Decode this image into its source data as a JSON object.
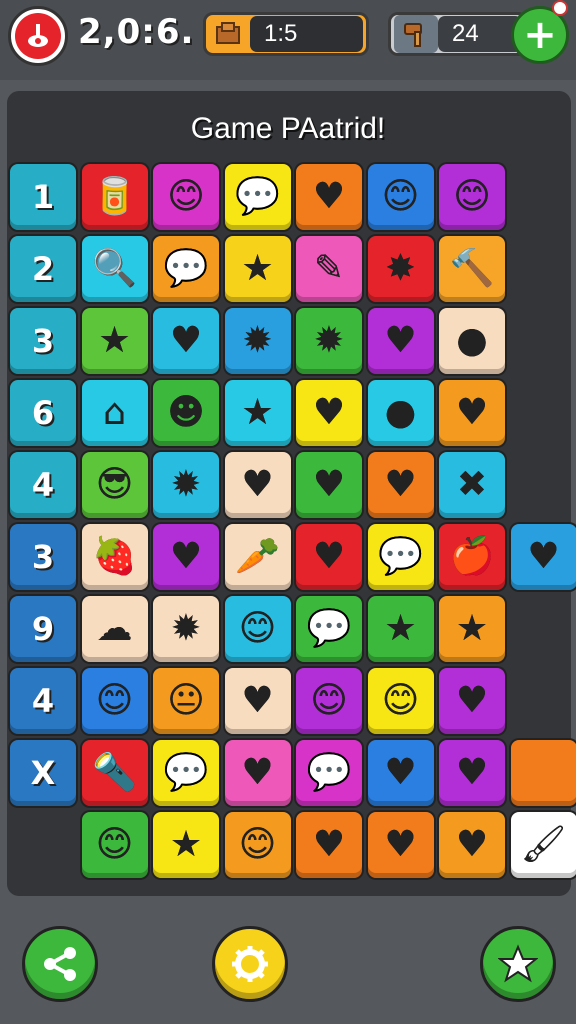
{
  "header": {
    "score": "2,0:6.",
    "resource1": {
      "value": "1:5",
      "icon": "wood-block-icon"
    },
    "resource2": {
      "value": "24",
      "icon": "hammer-icon"
    },
    "add_label": "+"
  },
  "board": {
    "title": "Game PAatrid!",
    "rows": [
      {
        "label": "1",
        "label_color": "#27aec6",
        "cells": [
          {
            "color": "#e4232b",
            "glyph": "🥫",
            "icon": "can-icon"
          },
          {
            "color": "#d733c8",
            "glyph": "😊",
            "icon": "face-icon"
          },
          {
            "color": "#f7e614",
            "glyph": "💬",
            "icon": "speech-bubble-icon"
          },
          {
            "color": "#f27c1c",
            "glyph": "♥",
            "icon": "heart-icon"
          },
          {
            "color": "#2a7fe0",
            "glyph": "😊",
            "icon": "face-icon"
          },
          {
            "color": "#b22ed6",
            "glyph": "😊",
            "icon": "face-icon"
          }
        ]
      },
      {
        "label": "2",
        "label_color": "#27aec6",
        "cells": [
          {
            "color": "#28c9e4",
            "glyph": "🔍",
            "icon": "magnifier-icon"
          },
          {
            "color": "#f39a1f",
            "glyph": "💬",
            "icon": "speech-bubble-icon"
          },
          {
            "color": "#f7d21b",
            "glyph": "★",
            "icon": "star-icon"
          },
          {
            "color": "#ee58b8",
            "glyph": "✎",
            "icon": "ribbon-icon"
          },
          {
            "color": "#e4232b",
            "glyph": "✸",
            "icon": "splat-icon"
          },
          {
            "color": "#f7a528",
            "glyph": "🔨",
            "icon": "hammer-icon"
          }
        ]
      },
      {
        "label": "3",
        "label_color": "#27aec6",
        "cells": [
          {
            "color": "#5cc53a",
            "glyph": "★",
            "icon": "star-icon"
          },
          {
            "color": "#28bde0",
            "glyph": "♥",
            "icon": "heart-icon"
          },
          {
            "color": "#2a9fe0",
            "glyph": "✹",
            "icon": "gear-badge-icon"
          },
          {
            "color": "#3cb83c",
            "glyph": "✹",
            "icon": "gear-badge-icon"
          },
          {
            "color": "#b22ed6",
            "glyph": "♥",
            "icon": "heart-icon"
          },
          {
            "color": "#f8dcc0",
            "glyph": "●",
            "icon": "bubble-icon"
          }
        ]
      },
      {
        "label": "6",
        "label_color": "#27aec6",
        "cells": [
          {
            "color": "#28c9e4",
            "glyph": "⌂",
            "icon": "house-icon"
          },
          {
            "color": "#3cb83c",
            "glyph": "☻",
            "icon": "blob-face-icon"
          },
          {
            "color": "#28c9e4",
            "glyph": "★",
            "icon": "star-icon"
          },
          {
            "color": "#f7e614",
            "glyph": "♥",
            "icon": "heart-icon"
          },
          {
            "color": "#28c9e4",
            "glyph": "●",
            "icon": "ball-icon"
          },
          {
            "color": "#f39a1f",
            "glyph": "♥",
            "icon": "heart-icon"
          }
        ]
      },
      {
        "label": "4",
        "label_color": "#27aec6",
        "cells": [
          {
            "color": "#5cc53a",
            "glyph": "😎",
            "icon": "face-icon"
          },
          {
            "color": "#28bde0",
            "glyph": "✹",
            "icon": "gear-badge-icon"
          },
          {
            "color": "#f8dcc0",
            "glyph": "♥",
            "icon": "heart-icon"
          },
          {
            "color": "#3cb83c",
            "glyph": "♥",
            "icon": "heart-icon"
          },
          {
            "color": "#f27c1c",
            "glyph": "♥",
            "icon": "heart-icon"
          },
          {
            "color": "#28bde0",
            "glyph": "✖",
            "icon": "cross-icon"
          }
        ]
      },
      {
        "label": "3",
        "label_color": "#2b78c2",
        "cells": [
          {
            "color": "#f8dcc0",
            "glyph": "🍓",
            "icon": "strawberry-icon"
          },
          {
            "color": "#b22ed6",
            "glyph": "♥",
            "icon": "heart-icon"
          },
          {
            "color": "#f8dcc0",
            "glyph": "🥕",
            "icon": "carrot-icon"
          },
          {
            "color": "#e4232b",
            "glyph": "♥",
            "icon": "heart-icon"
          },
          {
            "color": "#f7e614",
            "glyph": "💬",
            "icon": "speech-bubble-icon"
          },
          {
            "color": "#e4232b",
            "glyph": "🍎",
            "icon": "apple-icon"
          },
          {
            "color": "#2a9fe0",
            "glyph": "♥",
            "icon": "heart-icon"
          }
        ]
      },
      {
        "label": "9",
        "label_color": "#2b78c2",
        "cells": [
          {
            "color": "#f8dcc0",
            "glyph": "☁",
            "icon": "cloud-icon"
          },
          {
            "color": "#f8dcc0",
            "glyph": "✹",
            "icon": "gear-badge-icon"
          },
          {
            "color": "#28bde0",
            "glyph": "😊",
            "icon": "face-icon"
          },
          {
            "color": "#3cb83c",
            "glyph": "💬",
            "icon": "speech-bubble-icon"
          },
          {
            "color": "#3cb83c",
            "glyph": "★",
            "icon": "star-icon"
          },
          {
            "color": "#f39a1f",
            "glyph": "★",
            "icon": "star-icon"
          }
        ]
      },
      {
        "label": "4",
        "label_color": "#2b78c2",
        "cells": [
          {
            "color": "#2a7fe0",
            "glyph": "😊",
            "icon": "face-icon"
          },
          {
            "color": "#f39a1f",
            "glyph": "😐",
            "icon": "face-icon"
          },
          {
            "color": "#f8dcc0",
            "glyph": "♥",
            "icon": "heart-icon"
          },
          {
            "color": "#b22ed6",
            "glyph": "😊",
            "icon": "face-icon"
          },
          {
            "color": "#f7e614",
            "glyph": "😊",
            "icon": "face-icon"
          },
          {
            "color": "#b22ed6",
            "glyph": "♥",
            "icon": "heart-icon"
          }
        ]
      },
      {
        "label": "X",
        "label_color": "#2b78c2",
        "cells": [
          {
            "color": "#e4232b",
            "glyph": "🔦",
            "icon": "flashlight-icon"
          },
          {
            "color": "#f7e614",
            "glyph": "💬",
            "icon": "speech-bubble-icon"
          },
          {
            "color": "#ee58b8",
            "glyph": "♥",
            "icon": "heart-icon"
          },
          {
            "color": "#d733c8",
            "glyph": "💬",
            "icon": "speech-bubble-icon"
          },
          {
            "color": "#2a7fe0",
            "glyph": "♥",
            "icon": "waffle-heart-icon"
          },
          {
            "color": "#b22ed6",
            "glyph": "♥",
            "icon": "heart-icon"
          },
          {
            "color": "#f27c1c",
            "glyph": "",
            "icon": "empty-tile-icon"
          }
        ]
      },
      {
        "label": "",
        "label_color": "",
        "cells": [
          {
            "color": "#3cb83c",
            "glyph": "😊",
            "icon": "face-icon"
          },
          {
            "color": "#f7e614",
            "glyph": "★",
            "icon": "star-icon"
          },
          {
            "color": "#f39a1f",
            "glyph": "😊",
            "icon": "face-icon"
          },
          {
            "color": "#f27c1c",
            "glyph": "♥",
            "icon": "heart-icon"
          },
          {
            "color": "#f27c1c",
            "glyph": "♥",
            "icon": "heart-icon"
          },
          {
            "color": "#f39a1f",
            "glyph": "♥",
            "icon": "heart-icon"
          },
          {
            "color": "#ffffff",
            "glyph": "🖌",
            "icon": "paint-brush-icon"
          }
        ]
      }
    ]
  },
  "footer": {
    "share": {
      "icon": "share-icon",
      "color": "#3db83c"
    },
    "settings": {
      "icon": "gear-icon",
      "color": "#f7d21b"
    },
    "favorite": {
      "icon": "star-icon",
      "color": "#3db83c"
    }
  }
}
